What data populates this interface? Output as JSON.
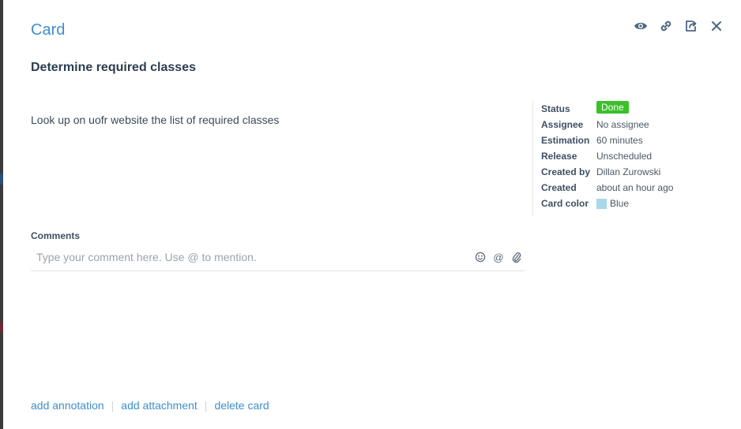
{
  "dialog": {
    "title": "Card",
    "icons": [
      "eye-icon",
      "link-icon",
      "share-icon",
      "close-icon"
    ]
  },
  "card": {
    "name": "Determine required classes",
    "description": "Look up on uofr website the list of required classes"
  },
  "meta": {
    "status_label": "Status",
    "status_value": "Done",
    "assignee_label": "Assignee",
    "assignee_value": "No assignee",
    "estimation_label": "Estimation",
    "estimation_value": "60 minutes",
    "release_label": "Release",
    "release_value": "Unscheduled",
    "created_by_label": "Created by",
    "created_by_value": "Dillan Zurowski",
    "created_label": "Created",
    "created_value": "about an hour ago",
    "color_label": "Card color",
    "color_value": "Blue"
  },
  "comments": {
    "label": "Comments",
    "placeholder": "Type your comment here. Use @ to mention.",
    "value": ""
  },
  "footer": {
    "add_annotation": "add annotation",
    "add_attachment": "add attachment",
    "delete_card": "delete card"
  },
  "colors": {
    "accent": "#3d8fd1",
    "status_done": "#3bbf2b",
    "card_color_blue": "#a9d8ea"
  }
}
